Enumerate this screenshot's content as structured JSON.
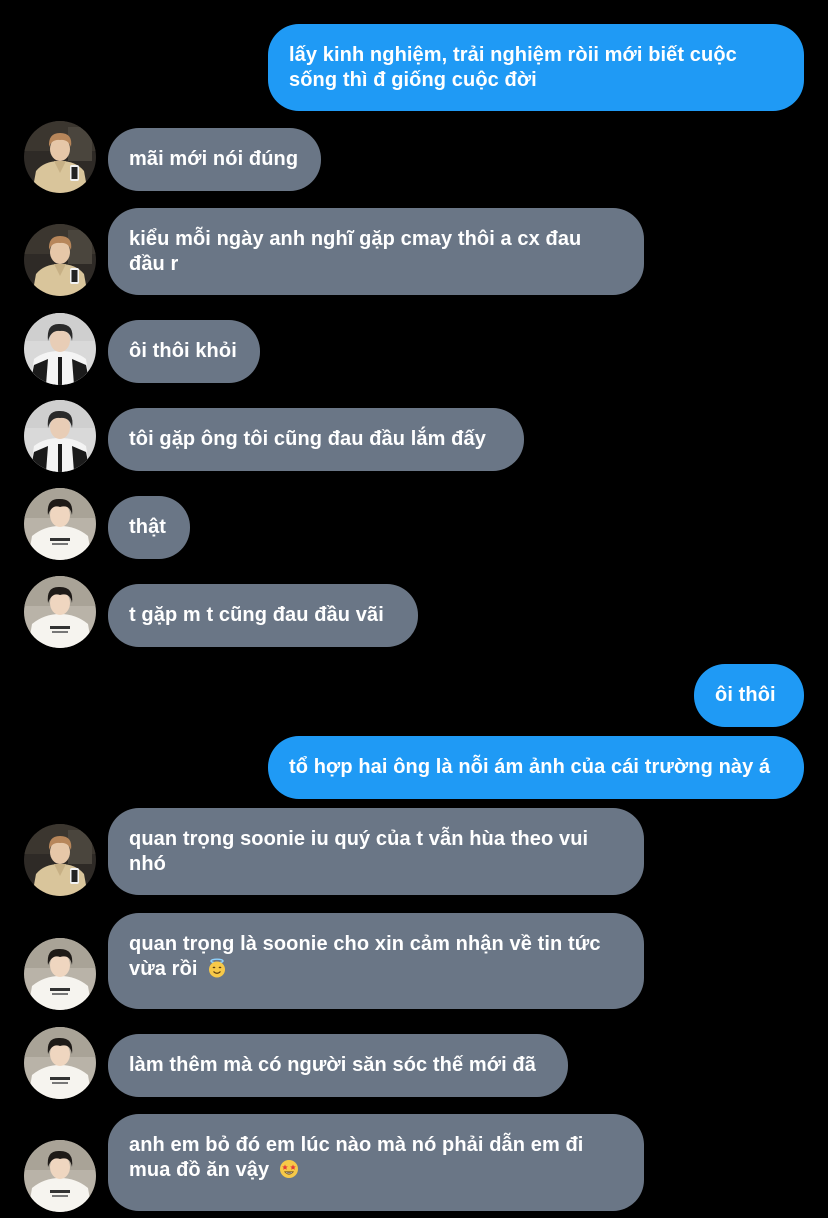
{
  "conversation": {
    "messages": [
      {
        "from": "me",
        "text": "lấy kinh nghiệm, trải nghiệm ròii mới biết cuộc sống thì đ giống cuộc đời"
      },
      {
        "from": "friend-a",
        "avatar": "avatar-beige-shirt",
        "text": "mãi mới nói đúng"
      },
      {
        "from": "friend-a",
        "avatar": "avatar-beige-shirt",
        "text": "kiểu mỗi ngày anh nghĩ gặp cmay thôi a cx đau đầu r"
      },
      {
        "from": "friend-b",
        "avatar": "avatar-dark-jacket",
        "text": "ôi thôi khỏi"
      },
      {
        "from": "friend-b",
        "avatar": "avatar-dark-jacket",
        "text": "tôi gặp ông tôi cũng đau đầu lắm đấy"
      },
      {
        "from": "friend-c",
        "avatar": "avatar-white-tshirt",
        "text": "thật"
      },
      {
        "from": "friend-c",
        "avatar": "avatar-white-tshirt",
        "text": "t gặp m t cũng đau đầu vãi"
      },
      {
        "from": "me",
        "text": "ôi thôi"
      },
      {
        "from": "me",
        "text": "tổ hợp hai ông là nỗi ám ảnh của cái trường này á"
      },
      {
        "from": "friend-a",
        "avatar": "avatar-beige-shirt",
        "text": "quan trọng soonie iu quý của t vẫn hùa theo vui nhó"
      },
      {
        "from": "friend-c",
        "avatar": "avatar-white-tshirt",
        "text": "quan trọng là soonie cho xin cảm nhận về tin tức vừa rồi",
        "emoji": "smiling-face-with-halo"
      },
      {
        "from": "friend-c",
        "avatar": "avatar-white-tshirt",
        "text": "làm thêm mà có người săn sóc thế mới đã"
      },
      {
        "from": "friend-c",
        "avatar": "avatar-white-tshirt",
        "text": "anh em bỏ đó em lúc nào mà nó phải dẫn em đi mua đồ ăn vậy",
        "emoji": "star-struck"
      }
    ]
  },
  "colors": {
    "background": "#000000",
    "incoming_bubble": "#6a7686",
    "outgoing_bubble": "#1f9af5",
    "text": "#ffffff"
  }
}
